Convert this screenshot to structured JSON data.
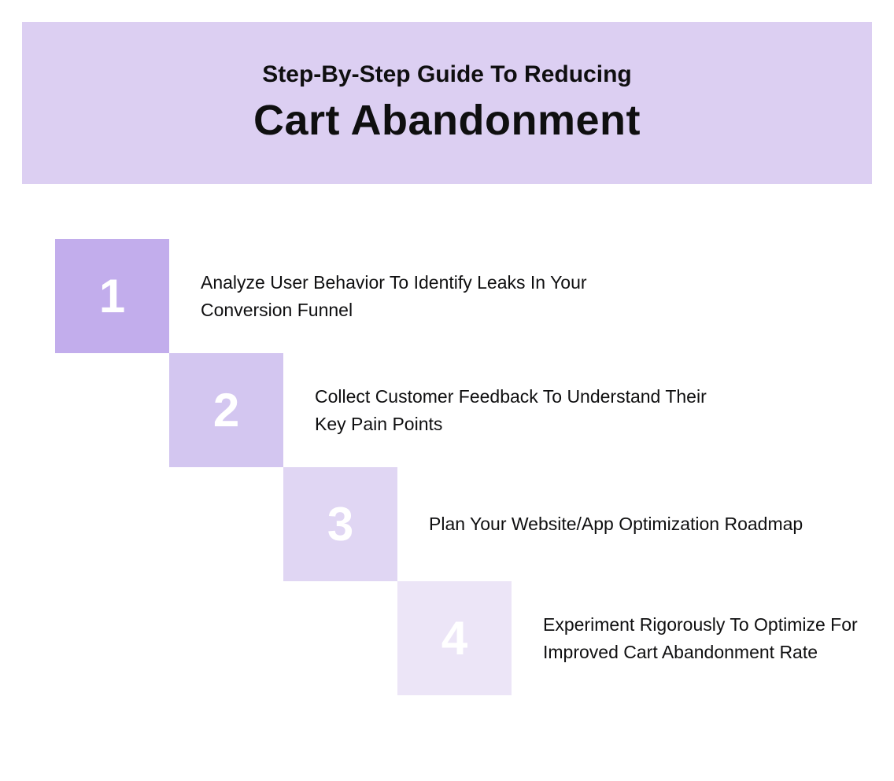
{
  "header": {
    "subtitle": "Step-By-Step Guide To Reducing",
    "title": "Cart Abandonment"
  },
  "steps": [
    {
      "number": "1",
      "text": "Analyze User Behavior To Identify Leaks In Your Conversion Funnel",
      "color": "#c2adec"
    },
    {
      "number": "2",
      "text": "Collect Customer Feedback To Understand Their Key Pain Points",
      "color": "#d3c6f0"
    },
    {
      "number": "3",
      "text": "Plan Your Website/App Optimization Roadmap",
      "color": "#e0d6f3"
    },
    {
      "number": "4",
      "text": "Experiment Rigorously To Optimize For Improved Cart Abandonment Rate",
      "color": "#ece5f7"
    }
  ]
}
